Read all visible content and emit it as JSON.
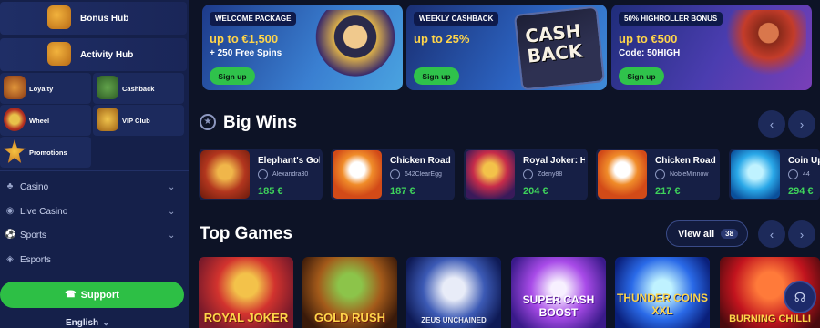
{
  "sidebar": {
    "hubs": [
      {
        "label": "Bonus Hub",
        "icon": "treasure-chest-icon"
      },
      {
        "label": "Activity Hub",
        "icon": "mascot-icon"
      }
    ],
    "tiles": [
      {
        "label": "Loyalty",
        "icon": "loyalty-icon"
      },
      {
        "label": "Cashback",
        "icon": "cashback-icon"
      },
      {
        "label": "Wheel",
        "icon": "wheel-icon"
      },
      {
        "label": "VIP Club",
        "icon": "vip-icon"
      },
      {
        "label": "Promotions",
        "icon": "star-icon"
      }
    ],
    "nav": [
      {
        "label": "Casino",
        "icon": "cards-icon"
      },
      {
        "label": "Live Casino",
        "icon": "live-icon"
      },
      {
        "label": "Sports",
        "icon": "ball-icon"
      },
      {
        "label": "Esports",
        "icon": "gamepad-icon"
      }
    ],
    "support_label": "Support",
    "language": "English"
  },
  "banners": [
    {
      "tag": "WELCOME PACKAGE",
      "line1": "up to €1,500",
      "line2": "+ 250 Free Spins",
      "button": "Sign up"
    },
    {
      "tag": "WEEKLY CASHBACK",
      "line1": "up to 25%",
      "line2": "",
      "button": "Sign up",
      "art_text": "CASH BACK"
    },
    {
      "tag": "50% HIGHROLLER BONUS",
      "line1": "up to €500",
      "line2": "Code: 50HIGH",
      "button": "Sign up"
    }
  ],
  "big_wins": {
    "title": "Big Wins",
    "items": [
      {
        "game": "Elephant's Gold",
        "user": "Alexandra30",
        "amount": "185 €"
      },
      {
        "game": "Chicken Road",
        "user": "642ClearEgg",
        "amount": "187 €"
      },
      {
        "game": "Royal Joker: Hold",
        "user": "Zdeny88",
        "amount": "204 €"
      },
      {
        "game": "Chicken Road",
        "user": "NobleMinnow",
        "amount": "217 €"
      },
      {
        "game": "Coin Up",
        "user": "44",
        "amount": "294 €"
      }
    ]
  },
  "top_games": {
    "title": "Top Games",
    "view_all": "View all",
    "count": "38",
    "games": [
      {
        "title": "ROYAL JOKER"
      },
      {
        "title": "GOLD RUSH"
      },
      {
        "title": "ZEUS UNCHAINED"
      },
      {
        "title": "SUPER CASH BOOST"
      },
      {
        "title": "THUNDER COINS XXL"
      },
      {
        "title": "BURNING CHILLI"
      }
    ]
  },
  "colors": {
    "accent_green": "#2dbf45",
    "background": "#0d1326",
    "sidebar": "#15204a",
    "win_amount": "#3ed15b"
  }
}
